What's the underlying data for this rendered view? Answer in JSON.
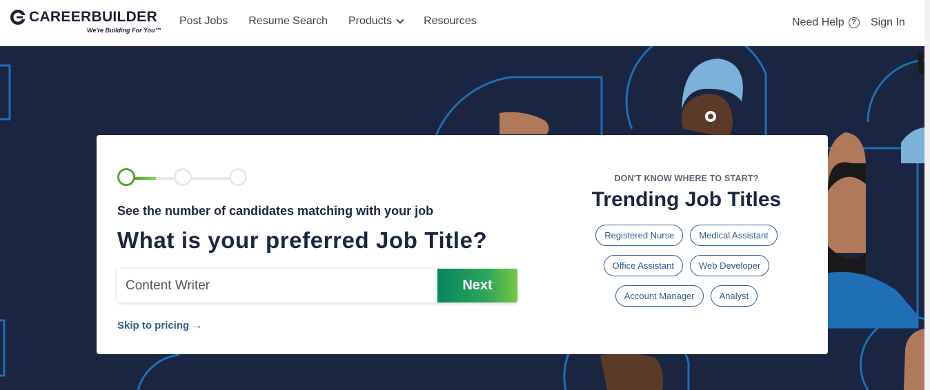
{
  "header": {
    "logo_text": "CAREERBUILDER",
    "logo_tagline": "We're Building For You™",
    "nav": [
      {
        "label": "Post Jobs"
      },
      {
        "label": "Resume Search"
      },
      {
        "label": "Products"
      },
      {
        "label": "Resources"
      }
    ],
    "need_help": "Need Help",
    "sign_in": "Sign In"
  },
  "stepper": {
    "current": 1,
    "total": 3
  },
  "form": {
    "subtitle": "See the number of candidates matching with your job",
    "question": "What is your preferred Job Title?",
    "input_value": "Content Writer",
    "next_label": "Next",
    "skip_label": "Skip to pricing →"
  },
  "trending": {
    "kicker": "DON'T KNOW WHERE TO START?",
    "title": "Trending Job Titles",
    "chips": [
      "Registered Nurse",
      "Medical Assistant",
      "Office Assistant",
      "Web Developer",
      "Account Manager",
      "Analyst"
    ]
  },
  "colors": {
    "hero_bg": "#1a2542",
    "accent_blue": "#2d5d8d",
    "next_green": "#2ba55b",
    "step_active": "#58a227"
  }
}
